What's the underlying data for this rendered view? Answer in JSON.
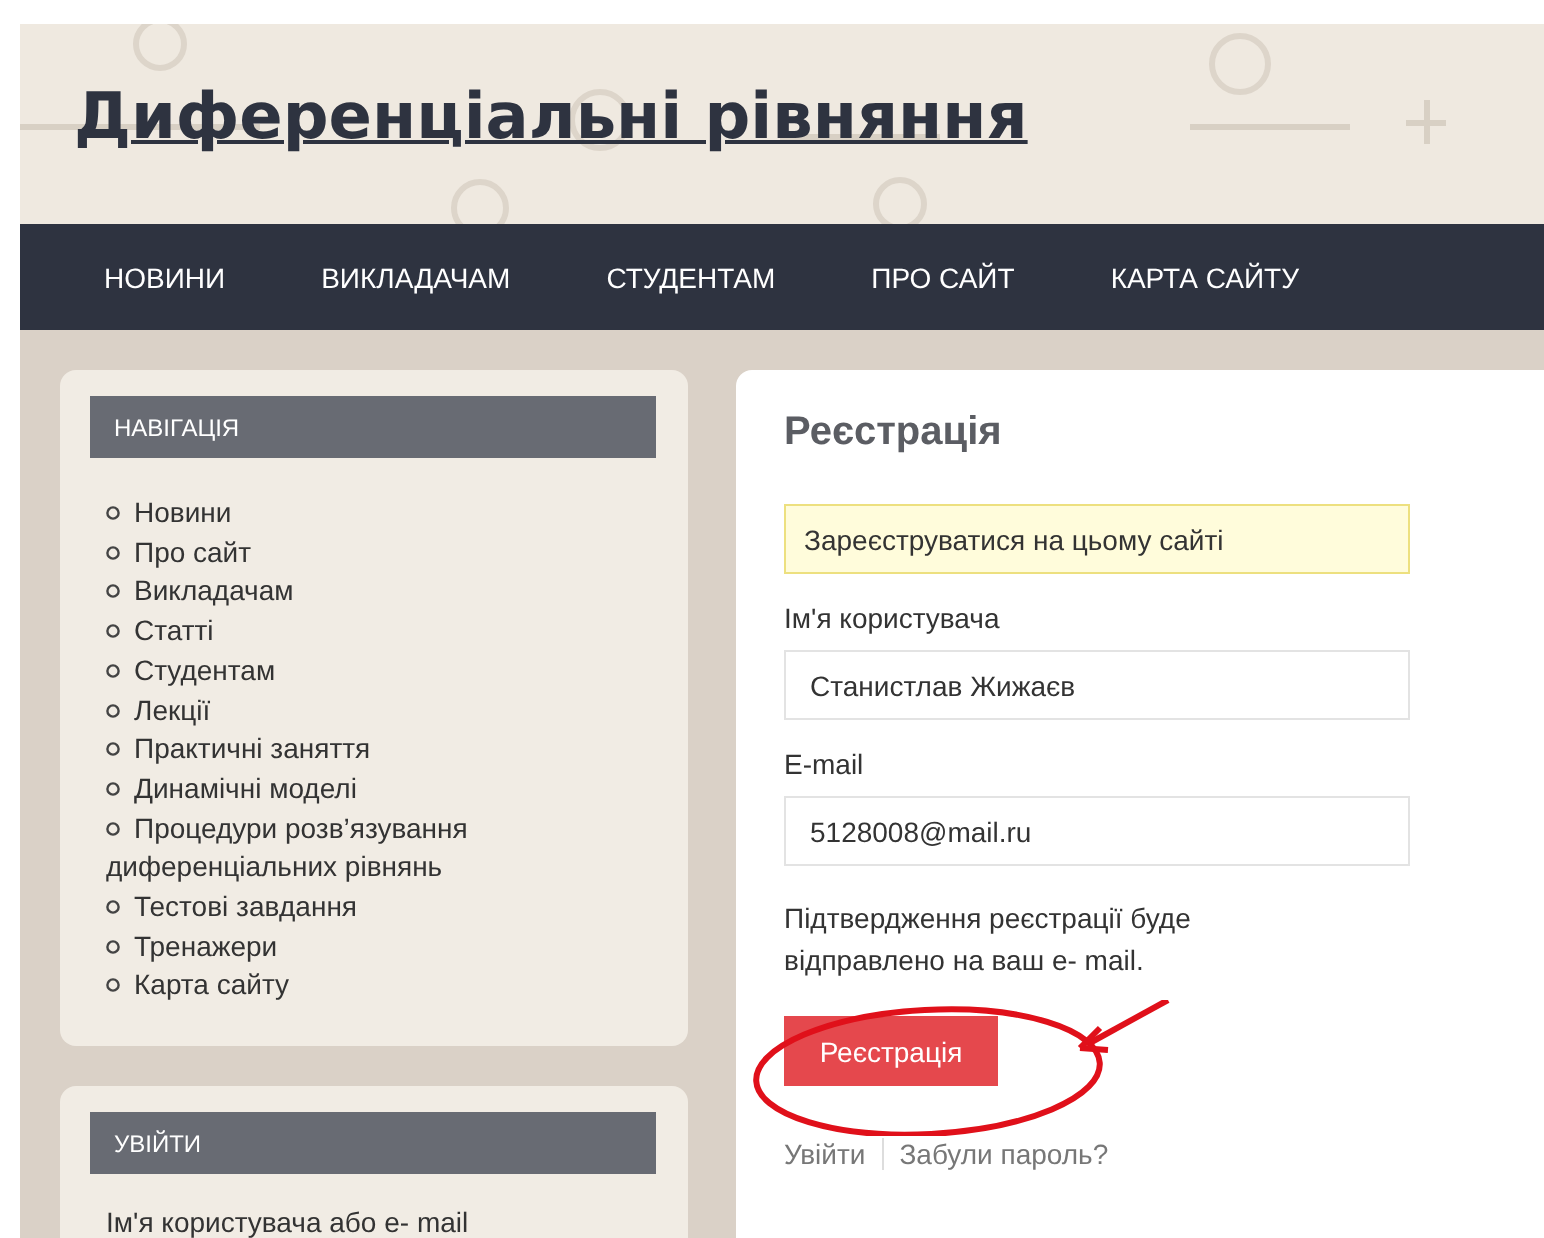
{
  "site": {
    "title": "Диференціальні рівняння"
  },
  "menu": [
    {
      "label": "НОВИНИ"
    },
    {
      "label": "ВИКЛАДАЧАМ"
    },
    {
      "label": "СТУДЕНТАМ"
    },
    {
      "label": "ПРО САЙТ"
    },
    {
      "label": "КАРТА САЙТУ"
    }
  ],
  "navigation": {
    "heading": "НАВІГАЦІЯ",
    "items": [
      "Новини",
      "Про сайт",
      "Викладачам",
      "Статті",
      "Студентам",
      "Лекції",
      "Практичні заняття",
      "Динамічні моделі",
      "Процедури розв’язування диференціальних рівнянь",
      "Тестові завдання",
      "Тренажери",
      "Карта сайту"
    ]
  },
  "login": {
    "heading": "УВІЙТИ",
    "username_label": "Ім'я користувача або e- mail"
  },
  "registration": {
    "title": "Реєстрація",
    "notice": "Зареєструватися на цьому сайті",
    "fields": [
      {
        "label": "Ім'я користувача",
        "value": "Станистлав Жижаєв"
      },
      {
        "label": "E-mail",
        "value": "5128008@mail.ru"
      }
    ],
    "note": "Підтвердження реєстрації буде відправлено на ваш e- mail.",
    "submit": "Реєстрація",
    "links": [
      "Увійти",
      "Забули пароль?"
    ]
  }
}
